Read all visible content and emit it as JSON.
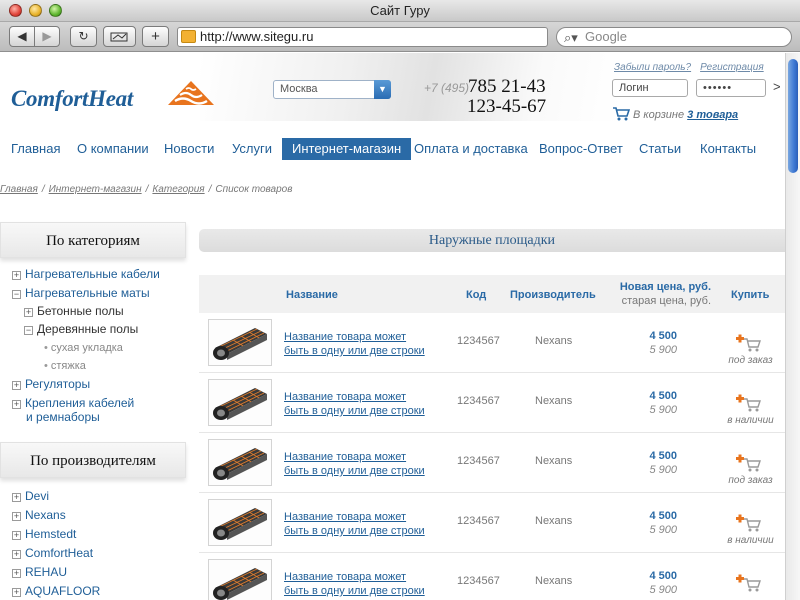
{
  "window": {
    "title": "Сайт Гуру"
  },
  "browser": {
    "url": "http://www.sitegu.ru",
    "search_placeholder": "Google",
    "back_glyph": "◀",
    "forward_glyph": "▶",
    "reload_glyph": "↻",
    "add_glyph": "+"
  },
  "header": {
    "logo_text": "ComfortHeat",
    "city": "Москва",
    "phone_code": "+7 (495)",
    "phone_1": "785 21-43",
    "phone_2": "123-45-67",
    "forgot_password": "Забыли пароль?",
    "register": "Регистрация",
    "login_value": "Логин",
    "password_value": "••••••",
    "login_go": ">",
    "cart_prefix": "В корзине",
    "cart_count": "3 товара"
  },
  "nav": {
    "items": [
      {
        "label": "Главная"
      },
      {
        "label": "О компании"
      },
      {
        "label": "Новости"
      },
      {
        "label": "Услуги"
      },
      {
        "label": "Интернет-магазин"
      },
      {
        "label": "Оплата и доставка"
      },
      {
        "label": "Вопрос-Ответ"
      },
      {
        "label": "Статьи"
      },
      {
        "label": "Контакты"
      }
    ],
    "active": "Интернет-магазин"
  },
  "breadcrumb": [
    "Главная",
    "Интернет-магазин",
    "Категория",
    "Список товаров"
  ],
  "sidebar": {
    "categories_title": "По категориям",
    "categories": [
      {
        "label": "Нагревательные кабели",
        "marker": "+"
      },
      {
        "label": "Нагревательные маты",
        "marker": "−"
      },
      {
        "label": "Бетонные полы",
        "marker": "+"
      },
      {
        "label": "Деревянные полы",
        "marker": "−"
      },
      {
        "label": "сухая укладка",
        "marker": "•"
      },
      {
        "label": "стяжка",
        "marker": "•"
      },
      {
        "label": "Регуляторы",
        "marker": "+"
      },
      {
        "label": "Крепления кабелей",
        "marker": "+"
      },
      {
        "label": "и ремнаборы",
        "marker": ""
      }
    ],
    "manufacturers_title": "По производителям",
    "manufacturers": [
      {
        "label": "Devi"
      },
      {
        "label": "Nexans"
      },
      {
        "label": "Hemstedt"
      },
      {
        "label": "ComfortHeat"
      },
      {
        "label": "REHAU"
      },
      {
        "label": "AQUAFLOOR"
      }
    ],
    "manufacturer_marker": "+"
  },
  "main": {
    "section_title": "Наружные площадки",
    "columns": {
      "name": "Название",
      "code": "Код",
      "maker": "Производитель",
      "new_price": "Новая цена, руб.",
      "old_price": "старая цена, руб.",
      "buy": "Купить"
    },
    "products": [
      {
        "name_line1": "Название товара может",
        "name_line2": "быть в одну или две строки",
        "code": "1234567",
        "maker": "Nexans",
        "new_price": "4 500",
        "old_price": "5 900",
        "status": "под заказ"
      },
      {
        "name_line1": "Название товара может",
        "name_line2": "быть в одну или две строки",
        "code": "1234567",
        "maker": "Nexans",
        "new_price": "4 500",
        "old_price": "5 900",
        "status": "в наличии"
      },
      {
        "name_line1": "Название товара может",
        "name_line2": "быть в одну или две строки",
        "code": "1234567",
        "maker": "Nexans",
        "new_price": "4 500",
        "old_price": "5 900",
        "status": "под заказ"
      },
      {
        "name_line1": "Название товара может",
        "name_line2": "быть в одну или две строки",
        "code": "1234567",
        "maker": "Nexans",
        "new_price": "4 500",
        "old_price": "5 900",
        "status": "в наличии"
      },
      {
        "name_line1": "Название товара может",
        "name_line2": "быть в одну или две строки",
        "code": "1234567",
        "maker": "Nexans",
        "new_price": "4 500",
        "old_price": "5 900",
        "status": ""
      }
    ]
  },
  "colors": {
    "brand_blue": "#1f5e97",
    "nav_active_bg": "#2a6aa6",
    "logo_orange": "#e8741e",
    "cart_plus": "#e8741e"
  }
}
